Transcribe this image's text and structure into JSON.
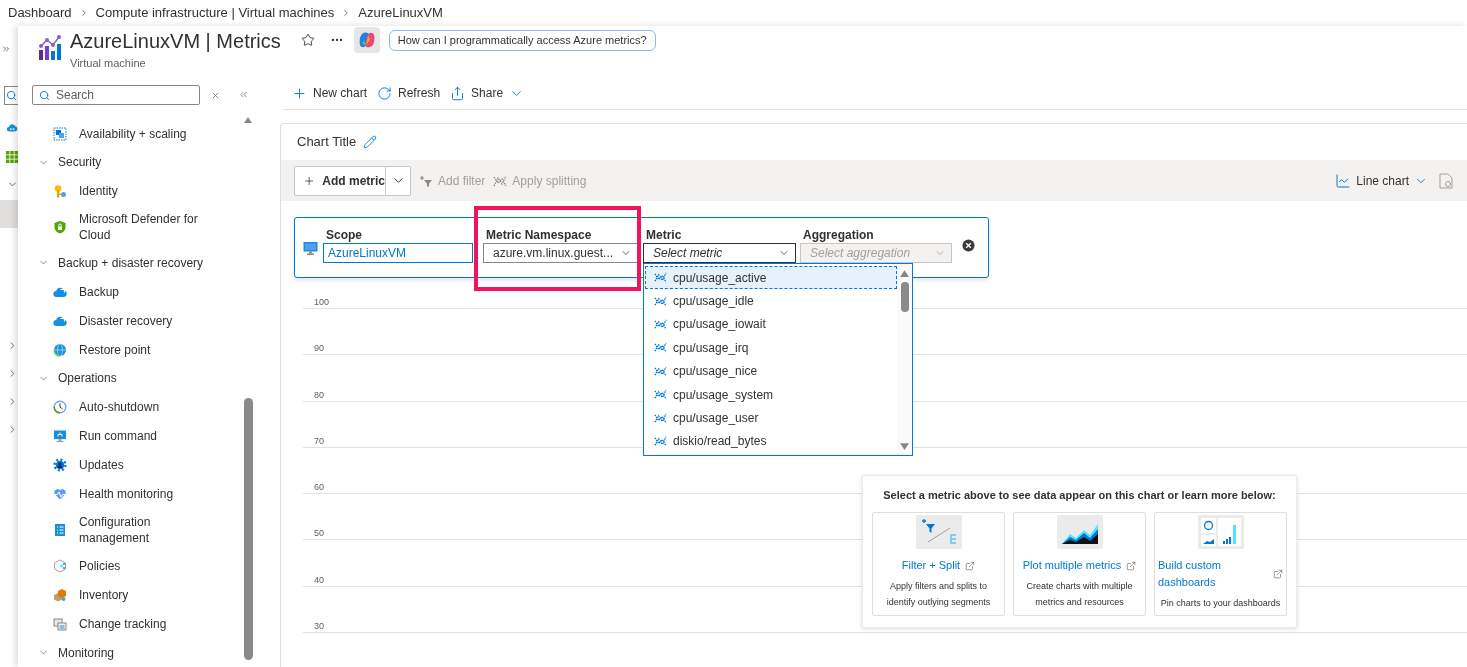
{
  "breadcrumb": [
    "Dashboard",
    "Compute infrastructure | Virtual machines",
    "AzureLinuxVM"
  ],
  "header": {
    "title": "AzureLinuxVM | Metrics",
    "subtitle": "Virtual machine",
    "prompt": "How can I programmatically access Azure metrics?"
  },
  "menu": {
    "search": {
      "placeholder": "Search"
    },
    "items": [
      {
        "kind": "item",
        "label": "Availability + scaling"
      },
      {
        "kind": "group",
        "label": "Security",
        "expanded": true,
        "children": [
          {
            "label": "Identity"
          },
          {
            "label": "Microsoft Defender for Cloud"
          }
        ]
      },
      {
        "kind": "group",
        "label": "Backup + disaster recovery",
        "expanded": true,
        "children": [
          {
            "label": "Backup"
          },
          {
            "label": "Disaster recovery"
          },
          {
            "label": "Restore point"
          }
        ]
      },
      {
        "kind": "group",
        "label": "Operations",
        "expanded": true,
        "children": [
          {
            "label": "Auto-shutdown"
          },
          {
            "label": "Run command"
          },
          {
            "label": "Updates"
          },
          {
            "label": "Health monitoring"
          },
          {
            "label": "Configuration management"
          },
          {
            "label": "Policies"
          },
          {
            "label": "Inventory"
          },
          {
            "label": "Change tracking"
          }
        ]
      },
      {
        "kind": "group",
        "label": "Monitoring",
        "expanded": true
      }
    ]
  },
  "toolbar": [
    {
      "kind": "button",
      "label": "New chart"
    },
    {
      "kind": "button",
      "label": "Refresh"
    },
    {
      "kind": "menu",
      "label": "Share"
    }
  ],
  "chart_card": {
    "title": "Chart Title",
    "add_metric": "Add metric",
    "actions": [
      {
        "label": "Add filter",
        "disabled": true
      },
      {
        "label": "Apply splitting",
        "disabled": true
      }
    ],
    "chart_type": "Line chart",
    "metric_editor": {
      "fields": [
        {
          "kind": "input",
          "label": "Scope",
          "value": "AzureLinuxVM",
          "disabled": false
        },
        {
          "kind": "select",
          "label": "Metric Namespace",
          "value": "azure.vm.linux.guest...",
          "disabled": false,
          "expanded": false
        },
        {
          "kind": "select",
          "label": "Metric",
          "placeholder": "Select metric",
          "disabled": false,
          "expanded": true,
          "options": [
            {
              "label": "cpu/usage_active",
              "selected": true
            },
            {
              "label": "cpu/usage_idle",
              "selected": false
            },
            {
              "label": "cpu/usage_iowait",
              "selected": false
            },
            {
              "label": "cpu/usage_irq",
              "selected": false
            },
            {
              "label": "cpu/usage_nice",
              "selected": false
            },
            {
              "label": "cpu/usage_system",
              "selected": false
            },
            {
              "label": "cpu/usage_user",
              "selected": false
            },
            {
              "label": "diskio/read_bytes",
              "selected": false
            }
          ]
        },
        {
          "kind": "select",
          "label": "Aggregation",
          "placeholder": "Select aggregation",
          "disabled": true,
          "expanded": false
        }
      ]
    },
    "y_axis_labels": [
      "100",
      "90",
      "80",
      "70",
      "60",
      "50",
      "40",
      "30"
    ],
    "help_panel": {
      "title": "Select a metric above to see data appear on this chart or learn more below:",
      "cards": [
        {
          "title": "Filter + Split",
          "description": "Apply filters and splits to identify outlying segments"
        },
        {
          "title": "Plot multiple metrics",
          "description": "Create charts with multiple metrics and resources"
        },
        {
          "title": "Build custom dashboards",
          "description": "Pin charts to your dashboards"
        }
      ]
    }
  }
}
